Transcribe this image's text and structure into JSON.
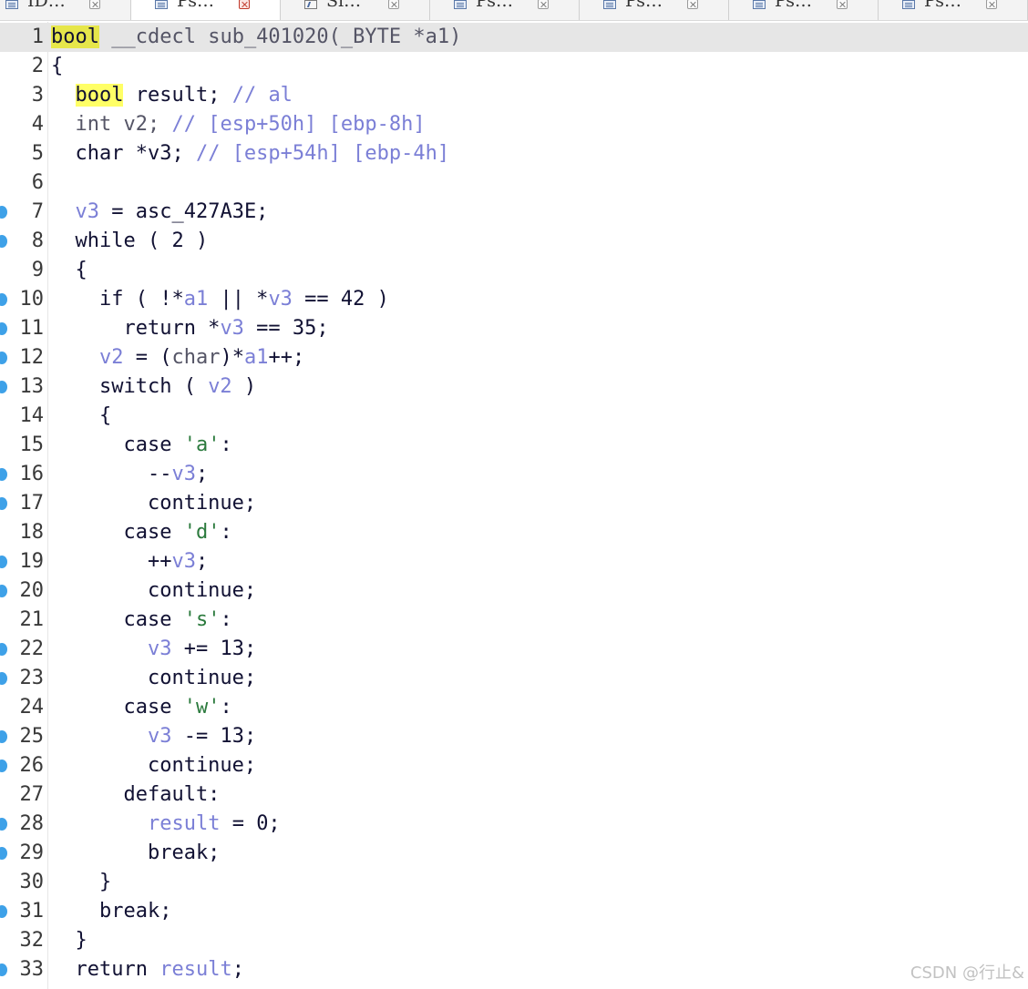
{
  "tabs": [
    {
      "label": "ID…",
      "icon": "pseudocode-icon",
      "active": false
    },
    {
      "label": "Ps…",
      "icon": "pseudocode-icon",
      "active": true
    },
    {
      "label": "Si…",
      "icon": "struct-icon",
      "active": false
    },
    {
      "label": "Ps…",
      "icon": "pseudocode-icon",
      "active": false
    },
    {
      "label": "Ps…",
      "icon": "pseudocode-icon",
      "active": false
    },
    {
      "label": "Ps…",
      "icon": "pseudocode-icon",
      "active": false
    },
    {
      "label": "Ps…",
      "icon": "pseudocode-icon",
      "active": false
    }
  ],
  "current_line": 1,
  "breakpoint_lines": [
    7,
    8,
    10,
    11,
    12,
    13,
    16,
    17,
    19,
    20,
    22,
    23,
    25,
    26,
    28,
    29,
    31,
    33
  ],
  "lines": [
    {
      "n": "1",
      "tokens": [
        [
          "hlcur",
          "bool"
        ],
        [
          "txt",
          " "
        ],
        [
          "gray",
          "__cdecl"
        ],
        [
          "txt",
          " "
        ],
        [
          "gray",
          "sub_401020"
        ],
        [
          "gray",
          "(_BYTE *a1)"
        ]
      ]
    },
    {
      "n": "2",
      "tokens": [
        [
          "txt",
          "{"
        ]
      ]
    },
    {
      "n": "3",
      "tokens": [
        [
          "txt",
          "  "
        ],
        [
          "hl",
          "bool"
        ],
        [
          "txt",
          " result; "
        ],
        [
          "cmt",
          "// al"
        ]
      ]
    },
    {
      "n": "4",
      "tokens": [
        [
          "txt",
          "  "
        ],
        [
          "gray",
          "int v2; "
        ],
        [
          "cmt",
          "// [esp+50h] [ebp-8h]"
        ]
      ]
    },
    {
      "n": "5",
      "tokens": [
        [
          "txt",
          "  char *v3; "
        ],
        [
          "cmt",
          "// [esp+54h] [ebp-4h]"
        ]
      ]
    },
    {
      "n": "6",
      "tokens": [
        [
          "txt",
          ""
        ]
      ]
    },
    {
      "n": "7",
      "tokens": [
        [
          "txt",
          "  "
        ],
        [
          "var",
          "v3"
        ],
        [
          "txt",
          " = asc_427A3E;"
        ]
      ]
    },
    {
      "n": "8",
      "tokens": [
        [
          "txt",
          "  while ( 2 )"
        ]
      ]
    },
    {
      "n": "9",
      "tokens": [
        [
          "txt",
          "  {"
        ]
      ]
    },
    {
      "n": "10",
      "tokens": [
        [
          "txt",
          "    if ( !*"
        ],
        [
          "var",
          "a1"
        ],
        [
          "txt",
          " || *"
        ],
        [
          "var",
          "v3"
        ],
        [
          "txt",
          " == 42 )"
        ]
      ]
    },
    {
      "n": "11",
      "tokens": [
        [
          "txt",
          "      return *"
        ],
        [
          "var",
          "v3"
        ],
        [
          "txt",
          " == 35;"
        ]
      ]
    },
    {
      "n": "12",
      "tokens": [
        [
          "txt",
          "    "
        ],
        [
          "var",
          "v2"
        ],
        [
          "txt",
          " = ("
        ],
        [
          "gray",
          "char"
        ],
        [
          "txt",
          ")*"
        ],
        [
          "var",
          "a1"
        ],
        [
          "txt",
          "++;"
        ]
      ]
    },
    {
      "n": "13",
      "tokens": [
        [
          "txt",
          "    switch ( "
        ],
        [
          "var",
          "v2"
        ],
        [
          "txt",
          " )"
        ]
      ]
    },
    {
      "n": "14",
      "tokens": [
        [
          "txt",
          "    {"
        ]
      ]
    },
    {
      "n": "15",
      "tokens": [
        [
          "txt",
          "      case "
        ],
        [
          "str",
          "'a'"
        ],
        [
          "txt",
          ":"
        ]
      ]
    },
    {
      "n": "16",
      "tokens": [
        [
          "txt",
          "        --"
        ],
        [
          "var",
          "v3"
        ],
        [
          "txt",
          ";"
        ]
      ]
    },
    {
      "n": "17",
      "tokens": [
        [
          "txt",
          "        continue;"
        ]
      ]
    },
    {
      "n": "18",
      "tokens": [
        [
          "txt",
          "      case "
        ],
        [
          "str",
          "'d'"
        ],
        [
          "txt",
          ":"
        ]
      ]
    },
    {
      "n": "19",
      "tokens": [
        [
          "txt",
          "        ++"
        ],
        [
          "var",
          "v3"
        ],
        [
          "txt",
          ";"
        ]
      ]
    },
    {
      "n": "20",
      "tokens": [
        [
          "txt",
          "        continue;"
        ]
      ]
    },
    {
      "n": "21",
      "tokens": [
        [
          "txt",
          "      case "
        ],
        [
          "str",
          "'s'"
        ],
        [
          "txt",
          ":"
        ]
      ]
    },
    {
      "n": "22",
      "tokens": [
        [
          "txt",
          "        "
        ],
        [
          "var",
          "v3"
        ],
        [
          "txt",
          " += 13;"
        ]
      ]
    },
    {
      "n": "23",
      "tokens": [
        [
          "txt",
          "        continue;"
        ]
      ]
    },
    {
      "n": "24",
      "tokens": [
        [
          "txt",
          "      case "
        ],
        [
          "str",
          "'w'"
        ],
        [
          "txt",
          ":"
        ]
      ]
    },
    {
      "n": "25",
      "tokens": [
        [
          "txt",
          "        "
        ],
        [
          "var",
          "v3"
        ],
        [
          "txt",
          " -= 13;"
        ]
      ]
    },
    {
      "n": "26",
      "tokens": [
        [
          "txt",
          "        continue;"
        ]
      ]
    },
    {
      "n": "27",
      "tokens": [
        [
          "txt",
          "      default:"
        ]
      ]
    },
    {
      "n": "28",
      "tokens": [
        [
          "txt",
          "        "
        ],
        [
          "var",
          "result"
        ],
        [
          "txt",
          " = 0;"
        ]
      ]
    },
    {
      "n": "29",
      "tokens": [
        [
          "txt",
          "        break;"
        ]
      ]
    },
    {
      "n": "30",
      "tokens": [
        [
          "txt",
          "    }"
        ]
      ]
    },
    {
      "n": "31",
      "tokens": [
        [
          "txt",
          "    break;"
        ]
      ]
    },
    {
      "n": "32",
      "tokens": [
        [
          "txt",
          "  }"
        ]
      ]
    },
    {
      "n": "33",
      "tokens": [
        [
          "txt",
          "  return "
        ],
        [
          "var",
          "result"
        ],
        [
          "txt",
          ";"
        ]
      ]
    }
  ],
  "watermark": "CSDN @行止&"
}
